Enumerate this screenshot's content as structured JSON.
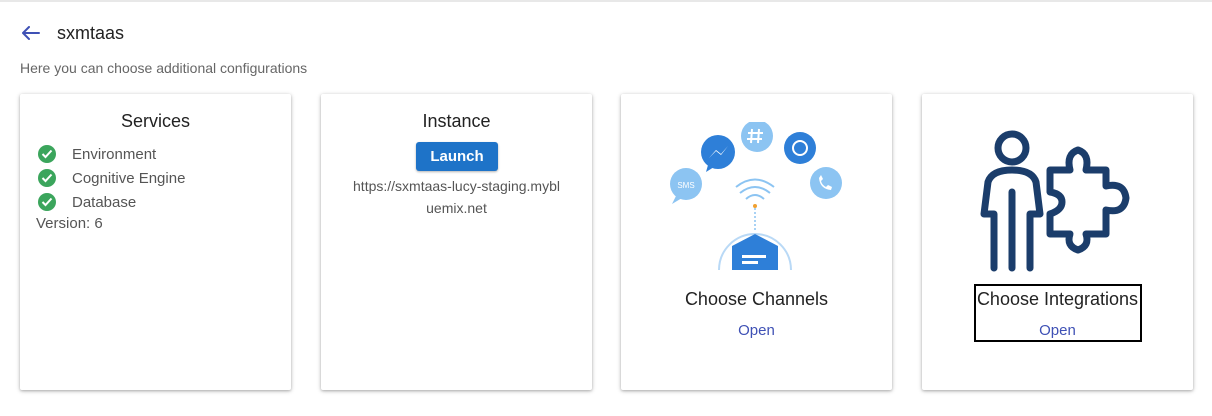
{
  "header": {
    "back_icon": "arrow-left-icon",
    "title": "sxmtaas",
    "subtitle": "Here you can choose additional configurations"
  },
  "colors": {
    "accent": "#1e73c8",
    "link": "#3f51b5",
    "check": "#3ba55c",
    "channel_icon": "#4a9bed",
    "integration_icon": "#1b3d6b"
  },
  "services": {
    "title": "Services",
    "items": [
      {
        "label": "Environment",
        "icon": "check-circle-icon"
      },
      {
        "label": "Cognitive Engine",
        "icon": "check-circle-icon"
      },
      {
        "label": "Database",
        "icon": "check-circle-icon"
      }
    ],
    "version": "Version: 6"
  },
  "instance": {
    "title": "Instance",
    "launch_label": "Launch",
    "url": "https://sxmtaas-lucy-staging.mybluemix.net"
  },
  "channels": {
    "title": "Choose Channels",
    "open_label": "Open",
    "illustration": "channels-illustration",
    "sms_label": "SMS"
  },
  "integrations": {
    "title": "Choose Integrations",
    "open_label": "Open",
    "illustration": "person-puzzle-icon"
  }
}
